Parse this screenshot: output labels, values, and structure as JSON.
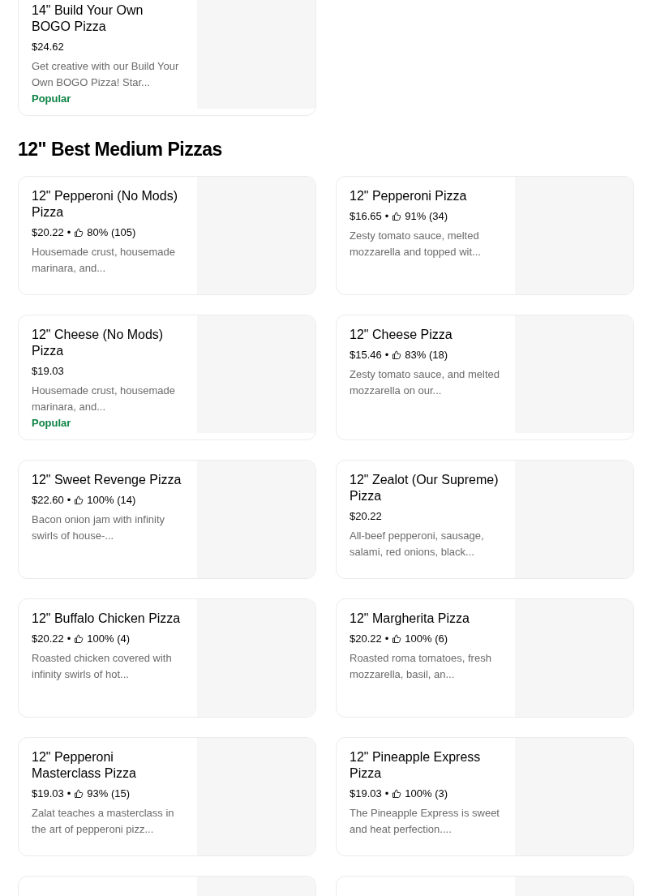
{
  "top_items": [
    {
      "kind": "item",
      "title": "14\" Build Your Own BOGO Pizza",
      "price": "$24.62",
      "description": "Get creative with our Build Your Own BOGO Pizza! Star...",
      "badge": "Popular"
    }
  ],
  "section": {
    "title": "12\" Best Medium Pizzas",
    "items": [
      {
        "kind": "item",
        "title": "12\" Pepperoni (No Mods) Pizza",
        "price": "$20.22",
        "separator": "•",
        "rating": "80% (105)",
        "description": "Housemade crust, housemade marinara, and..."
      },
      {
        "kind": "item",
        "title": "12\" Pepperoni Pizza",
        "price": "$16.65",
        "separator": "•",
        "rating": "91% (34)",
        "description": "Zesty tomato sauce, melted mozzarella and topped wit..."
      },
      {
        "kind": "item",
        "title": "12\" Cheese (No Mods) Pizza",
        "price": "$19.03",
        "description": "Housemade crust, housemade marinara, and...",
        "badge": "Popular"
      },
      {
        "kind": "item",
        "title": "12\" Cheese Pizza",
        "price": "$15.46",
        "separator": "•",
        "rating": "83% (18)",
        "description": "Zesty tomato sauce, and melted mozzarella on our..."
      },
      {
        "kind": "item",
        "title": "12\" Sweet Revenge Pizza",
        "price": "$22.60",
        "separator": "•",
        "rating": "100% (14)",
        "description": "Bacon onion jam with infinity swirls of house-..."
      },
      {
        "kind": "item",
        "title": "12\" Zealot (Our Supreme) Pizza",
        "price": "$20.22",
        "description": "All-beef pepperoni, sausage, salami, red onions, black..."
      },
      {
        "kind": "item",
        "title": "12\" Buffalo Chicken Pizza",
        "price": "$20.22",
        "separator": "•",
        "rating": "100% (4)",
        "description": "Roasted chicken covered with infinity swirls of hot..."
      },
      {
        "kind": "item",
        "title": "12\" Margherita Pizza",
        "price": "$20.22",
        "separator": "•",
        "rating": "100% (6)",
        "description": "Roasted roma tomatoes, fresh mozzarella, basil, an..."
      },
      {
        "kind": "item",
        "title": "12\" Pepperoni Masterclass Pizza",
        "price": "$19.03",
        "separator": "•",
        "rating": "93% (15)",
        "description": "Zalat teaches a masterclass in the art of pepperoni pizz..."
      },
      {
        "kind": "item",
        "title": "12\" Pineapple Express Pizza",
        "price": "$19.03",
        "separator": "•",
        "rating": "100% (3)",
        "description": "The Pineapple Express is sweet and heat perfection...."
      },
      {
        "kind": "cut"
      },
      {
        "kind": "cut"
      }
    ]
  }
}
